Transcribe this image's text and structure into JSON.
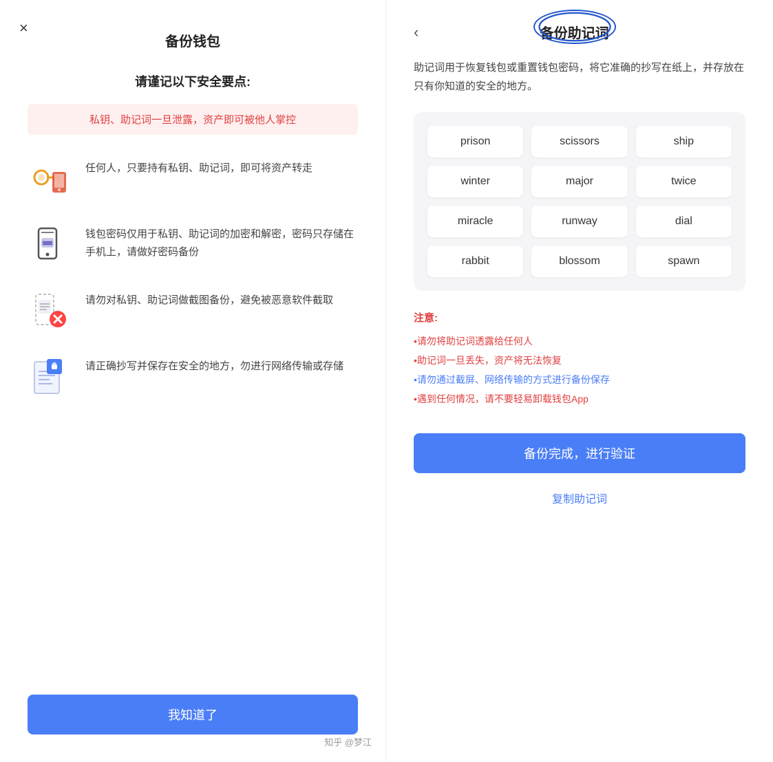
{
  "left": {
    "close_icon": "×",
    "title": "备份钱包",
    "subtitle": "请谨记以下安全要点:",
    "warning_text": "私钥、助记词一旦泄露，资产即可被他人掌控",
    "features": [
      {
        "id": "key-phone",
        "text": "任何人，只要持有私钥、助记词，即可将资产转走"
      },
      {
        "id": "password",
        "text": "钱包密码仅用于私钥、助记词的加密和解密，密码只存储在手机上，请做好密码备份"
      },
      {
        "id": "screenshot",
        "text": "请勿对私钥、助记词做截图备份，避免被恶意软件截取"
      },
      {
        "id": "document",
        "text": "请正确抄写并保存在安全的地方，勿进行网络传输或存储"
      }
    ],
    "confirm_btn": "我知道了"
  },
  "right": {
    "back_icon": "‹",
    "title": "备份助记词",
    "description": "助记词用于恢复钱包或重置钱包密码，将它准确的抄写在纸上，并存放在只有你知道的安全的地方。",
    "mnemonic_words": [
      "prison",
      "scissors",
      "ship",
      "winter",
      "major",
      "twice",
      "miracle",
      "runway",
      "dial",
      "rabbit",
      "blossom",
      "spawn"
    ],
    "notice_title": "注意:",
    "notices": [
      {
        "text": "•请勿将助记词透露给任何人",
        "color": "red"
      },
      {
        "text": "•助记词一旦丢失，资产将无法恢复",
        "color": "red"
      },
      {
        "text": "•请勿通过截屏、网络传输的方式进行备份保存",
        "color": "blue"
      },
      {
        "text": "•遇到任何情况，请不要轻易卸载钱包App",
        "color": "red"
      }
    ],
    "confirm_btn": "备份完成，进行验证",
    "copy_link": "复制助记词"
  },
  "watermark": "知乎 @梦江"
}
